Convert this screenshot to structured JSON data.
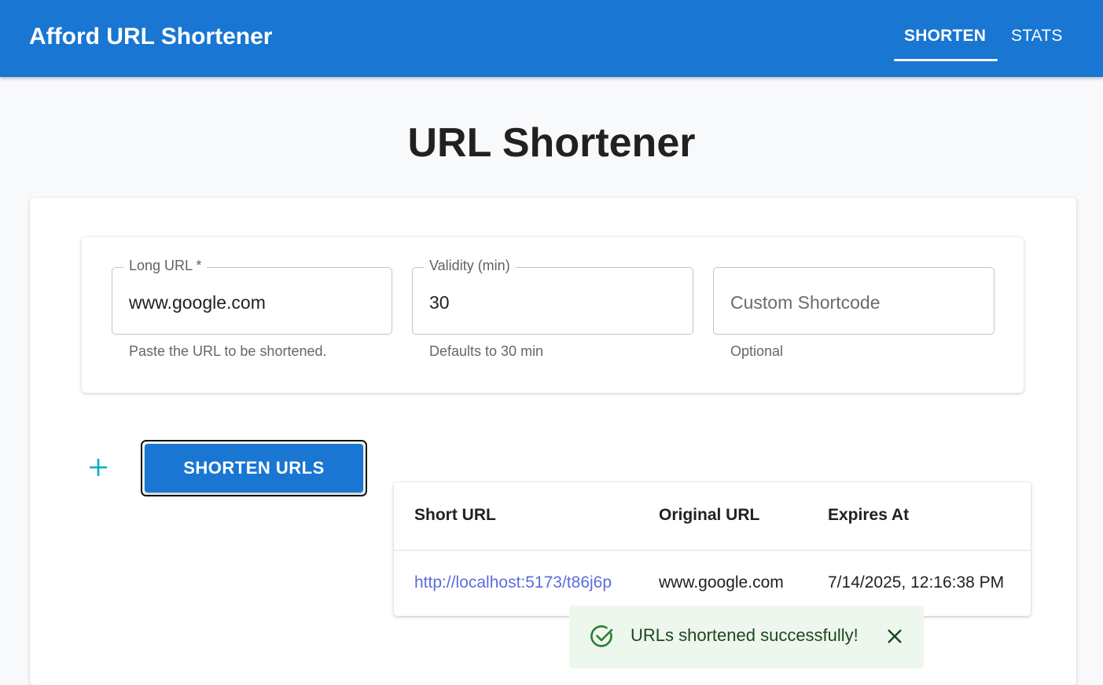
{
  "appbar": {
    "title": "Afford URL Shortener",
    "tabs": [
      {
        "label": "SHORTEN",
        "active": true
      },
      {
        "label": "STATS",
        "active": false
      }
    ],
    "color": "#1976d2"
  },
  "page": {
    "title": "URL Shortener"
  },
  "form": {
    "long_url": {
      "label": "Long URL *",
      "value": "www.google.com",
      "helper": "Paste the URL to be shortened."
    },
    "validity": {
      "label": "Validity (min)",
      "value": "30",
      "helper": "Defaults to 30 min"
    },
    "shortcode": {
      "placeholder": "Custom Shortcode",
      "value": "",
      "helper": "Optional"
    }
  },
  "actions": {
    "add_icon": "plus-icon",
    "shorten_label": "SHORTEN URLS"
  },
  "results": {
    "headers": [
      "Short URL",
      "Original URL",
      "Expires At"
    ],
    "rows": [
      {
        "short_url": "http://localhost:5173/t86j6p",
        "original_url": "www.google.com",
        "expires_at": "7/14/2025, 12:16:38 PM"
      }
    ]
  },
  "snackbar": {
    "message": "URLs shortened successfully!",
    "icon": "check-circle-icon",
    "close_icon": "close-icon",
    "severity": "success"
  }
}
